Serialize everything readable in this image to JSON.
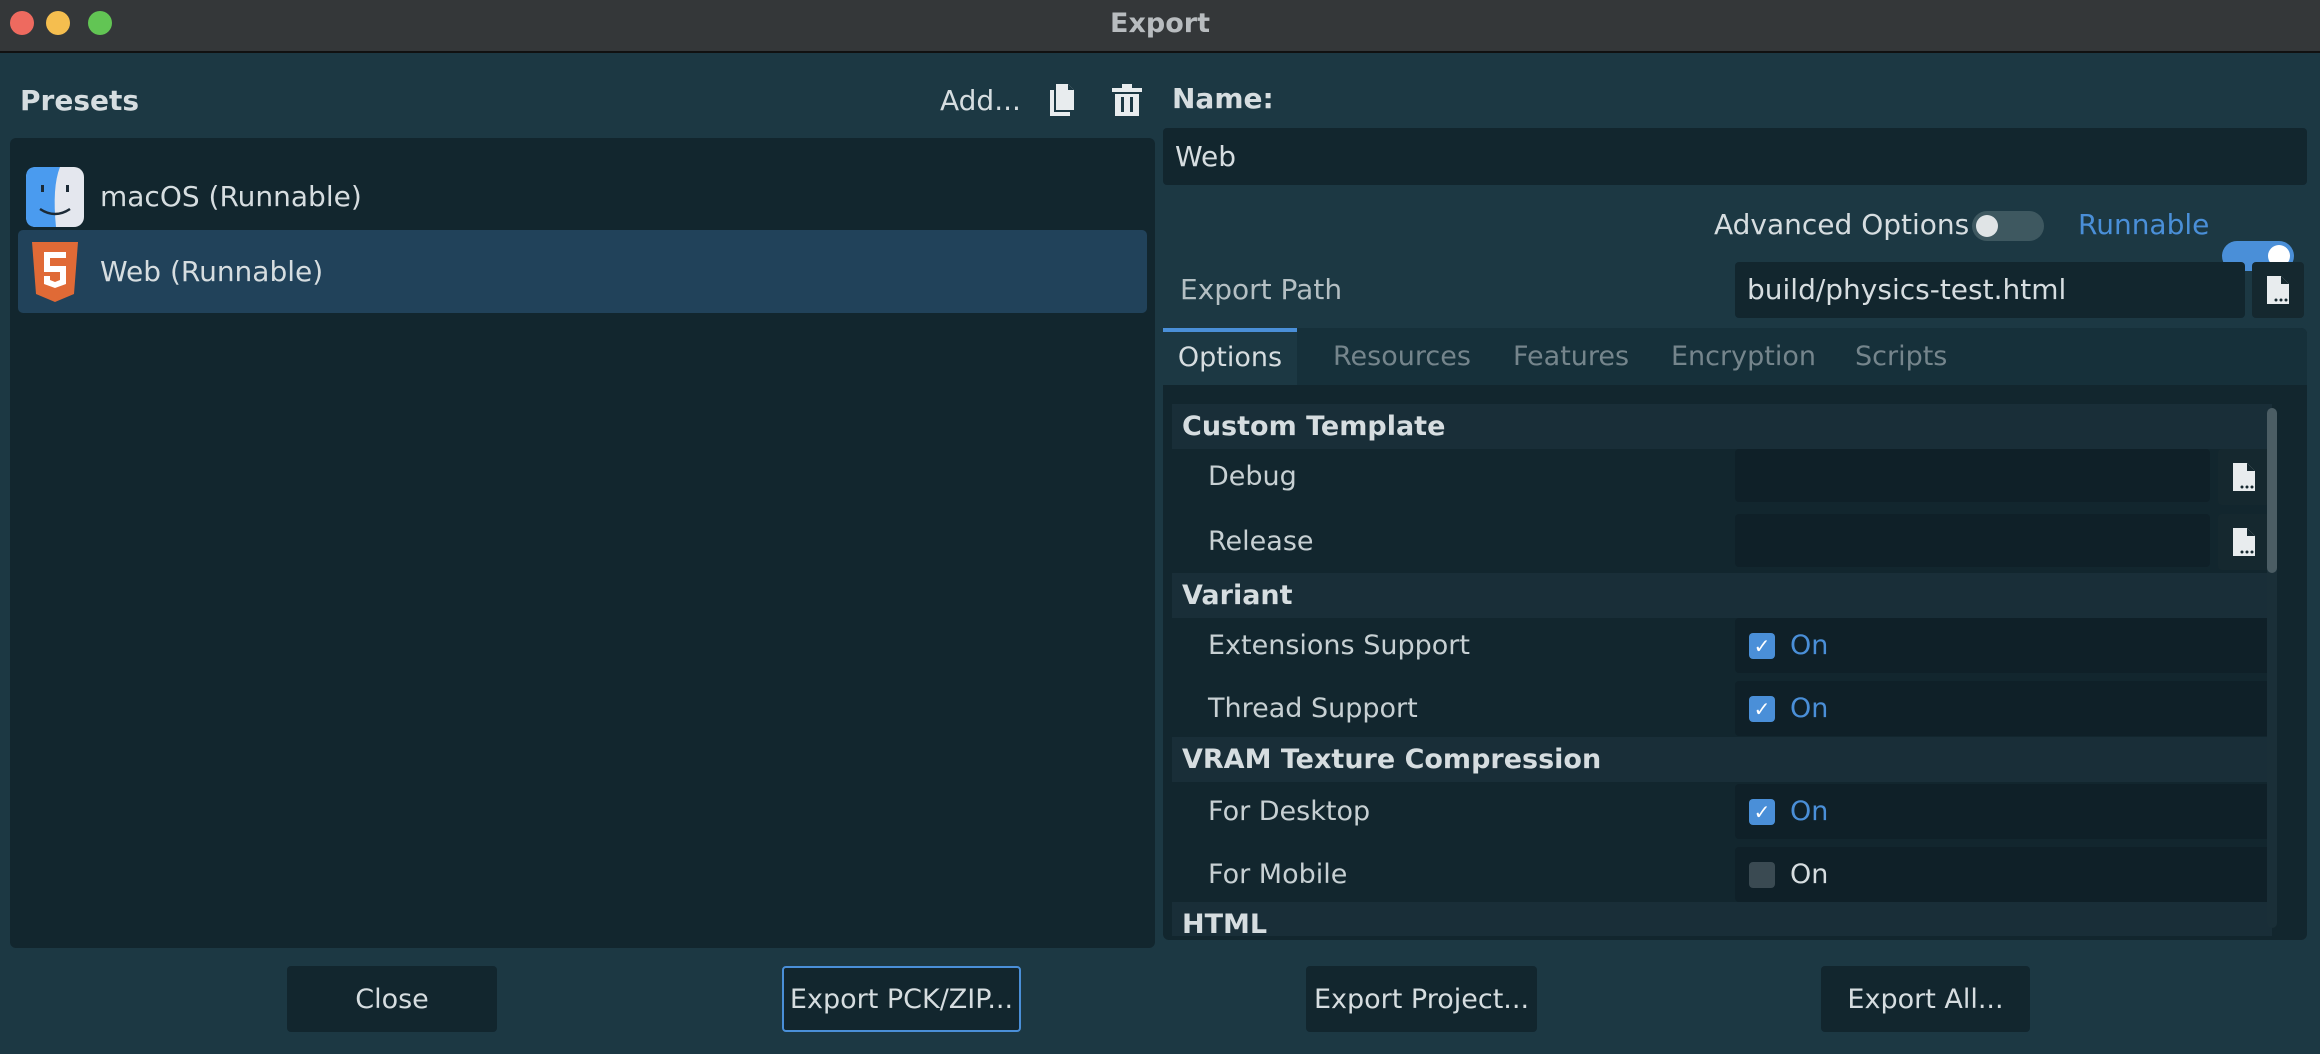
{
  "window": {
    "title": "Export",
    "traffic_lights": [
      "#ee6a5f",
      "#f5be4f",
      "#62c554"
    ]
  },
  "presets": {
    "label": "Presets",
    "add_label": "Add...",
    "items": [
      {
        "label": "macOS (Runnable)",
        "icon": "finder-icon",
        "selected": false
      },
      {
        "label": "Web (Runnable)",
        "icon": "html5-icon",
        "selected": true
      }
    ]
  },
  "name": {
    "label": "Name:",
    "value": "Web"
  },
  "toggles": {
    "advanced_label": "Advanced Options",
    "advanced_on": false,
    "runnable_label": "Runnable",
    "runnable_on": true
  },
  "export_path": {
    "label": "Export Path",
    "value": "build/physics-test.html"
  },
  "tabs": [
    {
      "label": "Options",
      "active": true
    },
    {
      "label": "Resources"
    },
    {
      "label": "Features"
    },
    {
      "label": "Encryption"
    },
    {
      "label": "Scripts"
    }
  ],
  "options": {
    "custom_template": {
      "label": "Custom Template",
      "debug": "Debug",
      "release": "Release"
    },
    "variant": {
      "label": "Variant",
      "extensions": {
        "label": "Extensions Support",
        "value": "On",
        "checked": true
      },
      "thread": {
        "label": "Thread Support",
        "value": "On",
        "checked": true
      }
    },
    "vram": {
      "label": "VRAM Texture Compression",
      "desktop": {
        "label": "For Desktop",
        "value": "On",
        "checked": true
      },
      "mobile": {
        "label": "For Mobile",
        "value": "On",
        "checked": false
      }
    },
    "html": {
      "label": "HTML"
    }
  },
  "buttons": {
    "close": "Close",
    "export_pck": "Export PCK/ZIP...",
    "export_project": "Export Project...",
    "export_all": "Export All..."
  },
  "colors": {
    "accent": "#4a8fd8",
    "background": "#1c3843",
    "panel": "#12262e",
    "selected": "#21425a"
  }
}
